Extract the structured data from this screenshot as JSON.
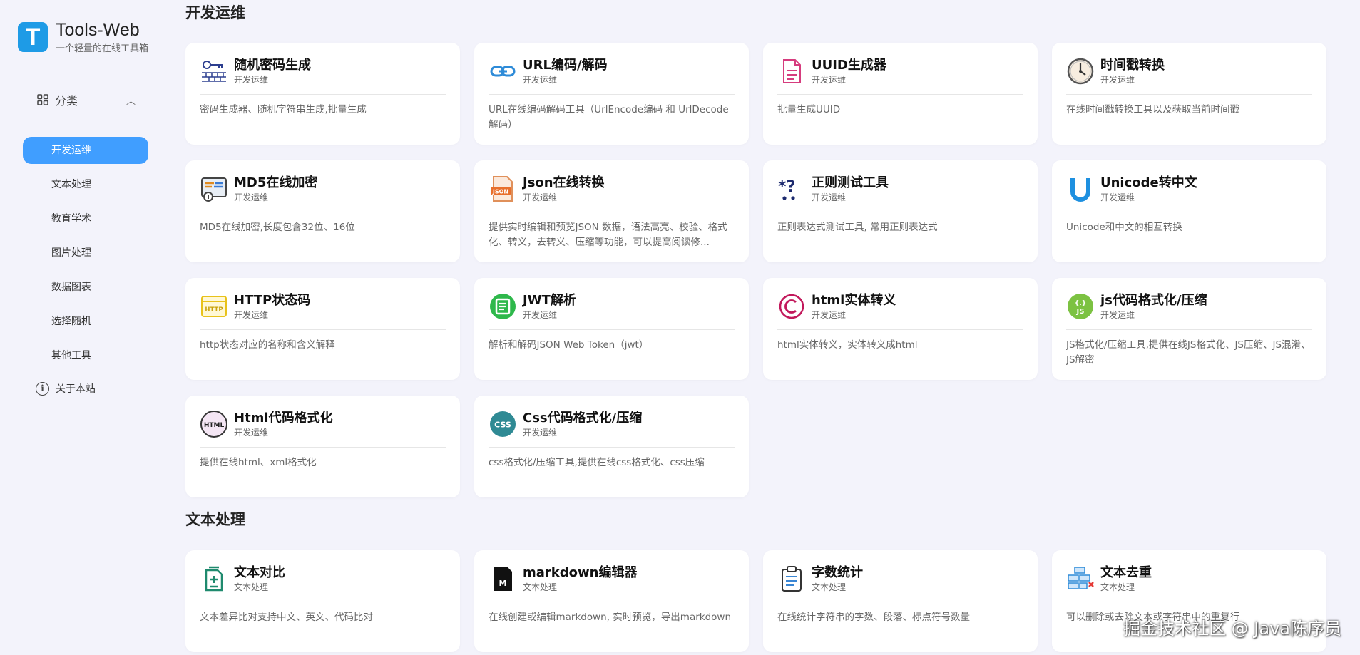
{
  "app": {
    "title": "Tools-Web",
    "subtitle": "一个轻量的在线工具箱"
  },
  "sidebar": {
    "category_label": "分类",
    "items": [
      {
        "label": "开发运维",
        "active": true
      },
      {
        "label": "文本处理",
        "active": false
      },
      {
        "label": "教育学术",
        "active": false
      },
      {
        "label": "图片处理",
        "active": false
      },
      {
        "label": "数据图表",
        "active": false
      },
      {
        "label": "选择随机",
        "active": false
      },
      {
        "label": "其他工具",
        "active": false
      }
    ],
    "about_label": "关于本站"
  },
  "sections": [
    {
      "title": "开发运维",
      "cards": [
        {
          "name": "随机密码生成",
          "category": "开发运维",
          "desc": "密码生成器、随机字符串生成,批量生成",
          "icon": "password-icon"
        },
        {
          "name": "URL编码/解码",
          "category": "开发运维",
          "desc": "URL在线编码解码工具（UrlEncode编码 和 UrlDecode解码）",
          "icon": "link-icon"
        },
        {
          "name": "UUID生成器",
          "category": "开发运维",
          "desc": "批量生成UUID",
          "icon": "document-icon"
        },
        {
          "name": "时间戳转换",
          "category": "开发运维",
          "desc": "在线时间戳转换工具以及获取当前时间戳",
          "icon": "clock-icon"
        },
        {
          "name": "MD5在线加密",
          "category": "开发运维",
          "desc": "MD5在线加密,长度包含32位、16位",
          "icon": "encrypt-icon"
        },
        {
          "name": "Json在线转换",
          "category": "开发运维",
          "desc": "提供实时编辑和预览JSON 数据，语法高亮、校验、格式化、转义，去转义、压缩等功能，可以提高阅读修...",
          "icon": "json-file-icon"
        },
        {
          "name": "正则测试工具",
          "category": "开发运维",
          "desc": "正则表达式测试工具, 常用正则表达式",
          "icon": "regex-icon"
        },
        {
          "name": "Unicode转中文",
          "category": "开发运维",
          "desc": "Unicode和中文的相互转换",
          "icon": "unicode-icon"
        },
        {
          "name": "HTTP状态码",
          "category": "开发运维",
          "desc": "http状态对应的名称和含义解释",
          "icon": "http-icon"
        },
        {
          "name": "JWT解析",
          "category": "开发运维",
          "desc": "解析和解码JSON Web Token（jwt）",
          "icon": "jwt-icon"
        },
        {
          "name": "html实体转义",
          "category": "开发运维",
          "desc": "html实体转义，实体转义成html",
          "icon": "copyright-icon"
        },
        {
          "name": "js代码格式化/压缩",
          "category": "开发运维",
          "desc": "JS格式化/压缩工具,提供在线JS格式化、JS压缩、JS混淆、JS解密",
          "icon": "js-icon"
        },
        {
          "name": "Html代码格式化",
          "category": "开发运维",
          "desc": "提供在线html、xml格式化",
          "icon": "html-icon"
        },
        {
          "name": "Css代码格式化/压缩",
          "category": "开发运维",
          "desc": "css格式化/压缩工具,提供在线css格式化、css压缩",
          "icon": "css-icon"
        }
      ]
    },
    {
      "title": "文本处理",
      "cards": [
        {
          "name": "文本对比",
          "category": "文本处理",
          "desc": "文本差异比对支持中文、英文、代码比对",
          "icon": "diff-icon"
        },
        {
          "name": "markdown编辑器",
          "category": "文本处理",
          "desc": "在线创建或编辑markdown, 实时预览，导出markdown",
          "icon": "markdown-icon"
        },
        {
          "name": "字数统计",
          "category": "文本处理",
          "desc": "在线统计字符串的字数、段落、标点符号数量",
          "icon": "clipboard-icon"
        },
        {
          "name": "文本去重",
          "category": "文本处理",
          "desc": "可以删除或去除文本或字符串中的重复行",
          "icon": "dedupe-icon"
        }
      ]
    }
  ],
  "watermark": "掘金技术社区 @ Java陈序员",
  "colors": {
    "accent": "#409eff",
    "page_bg": "#f3f3fb",
    "logo": "#1e9be6"
  }
}
